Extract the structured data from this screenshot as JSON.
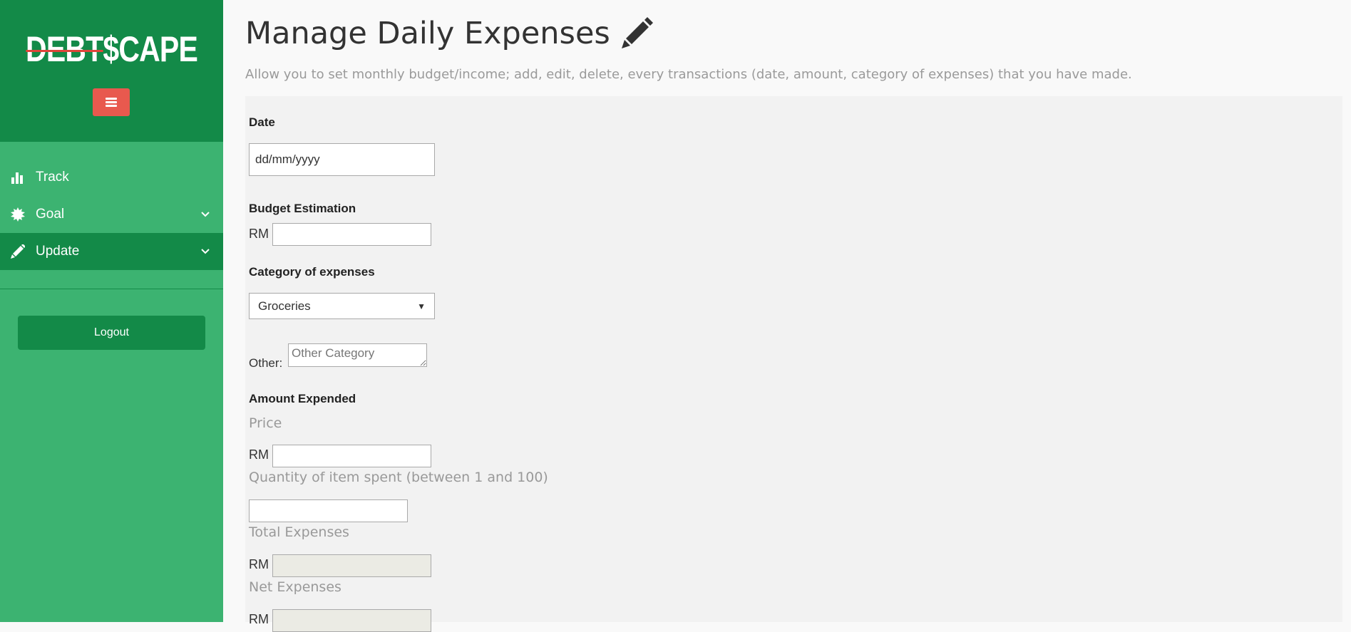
{
  "sidebar": {
    "logo_text": "DEBT$CAPE",
    "items": [
      {
        "label": "Track",
        "icon": "bar-chart-icon"
      },
      {
        "label": "Goal",
        "icon": "certificate-icon"
      },
      {
        "label": "Update",
        "icon": "pencil-icon"
      }
    ],
    "logout_label": "Logout"
  },
  "header": {
    "title": "Manage Daily Expenses",
    "description": "Allow you to set monthly budget/income; add, edit, delete, every transactions (date, amount, category of expenses) that you have made."
  },
  "form": {
    "date": {
      "label": "Date",
      "value": "dd/mm/yyyy"
    },
    "budget": {
      "label": "Budget Estimation",
      "currency": "RM",
      "value": ""
    },
    "category": {
      "label": "Category of expenses",
      "selected": "Groceries"
    },
    "other": {
      "label": "Other:",
      "placeholder": "Other Category"
    },
    "amount": {
      "label": "Amount Expended",
      "price_label": "Price",
      "price_currency": "RM",
      "quantity_label": "Quantity of item spent (between 1 and 100)",
      "total_label": "Total Expenses",
      "total_currency": "RM",
      "net_label": "Net Expenses",
      "net_currency": "RM"
    }
  },
  "colors": {
    "sidebar": "#3cb371",
    "sidebar_dark": "#138a48",
    "toggle": "#e8594e",
    "panel": "#f2f2f2"
  }
}
